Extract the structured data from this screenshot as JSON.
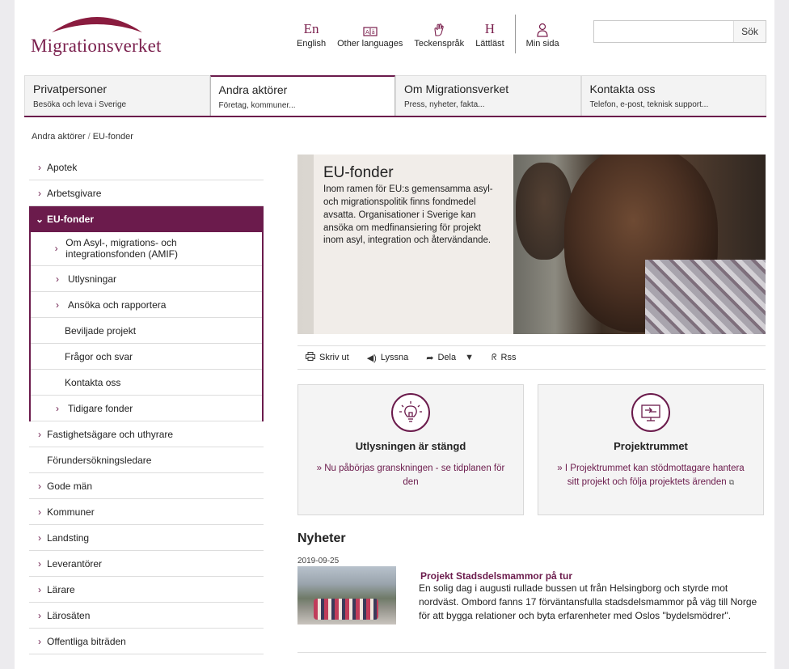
{
  "header": {
    "logo_text": "Migrationsverket",
    "top_links": [
      {
        "glyph": "En",
        "label": "English",
        "icon": "english-icon"
      },
      {
        "glyph": "A|ä",
        "label": "Other languages",
        "icon": "languages-icon"
      },
      {
        "glyph": "✋",
        "label": "Teckenspråk",
        "icon": "sign-language-icon"
      },
      {
        "glyph": "H",
        "label": "Lättläst",
        "icon": "easy-read-icon"
      }
    ],
    "my_page": {
      "label": "Min sida",
      "icon": "user-icon"
    },
    "search": {
      "placeholder": "",
      "button_label": "Sök"
    }
  },
  "main_nav": [
    {
      "title": "Privatpersoner",
      "subtitle": "Besöka och leva i Sverige"
    },
    {
      "title": "Andra aktörer",
      "subtitle": "Företag, kommuner..."
    },
    {
      "title": "Om Migrationsverket",
      "subtitle": "Press, nyheter, fakta..."
    },
    {
      "title": "Kontakta oss",
      "subtitle": "Telefon, e-post, teknisk support..."
    }
  ],
  "breadcrumb": {
    "parent": "Andra aktörer",
    "separator": "/",
    "current": "EU-fonder"
  },
  "sidebar": {
    "before": [
      {
        "label": "Apotek",
        "chevron": true
      },
      {
        "label": "Arbetsgivare",
        "chevron": true
      }
    ],
    "active": {
      "label": "EU-fonder"
    },
    "children": [
      {
        "label": "Om Asyl-, migrations- och integrationsfonden (AMIF)",
        "chevron": true
      },
      {
        "label": "Utlysningar",
        "chevron": true
      },
      {
        "label": "Ansöka och rapportera",
        "chevron": true
      },
      {
        "label": "Beviljade projekt",
        "chevron": false
      },
      {
        "label": "Frågor och svar",
        "chevron": false
      },
      {
        "label": "Kontakta oss",
        "chevron": false
      },
      {
        "label": "Tidigare fonder",
        "chevron": true
      }
    ],
    "after": [
      {
        "label": "Fastighetsägare och uthyrare",
        "chevron": true
      },
      {
        "label": "Förundersökningsledare",
        "chevron": false
      },
      {
        "label": "Gode män",
        "chevron": true
      },
      {
        "label": "Kommuner",
        "chevron": true
      },
      {
        "label": "Landsting",
        "chevron": true
      },
      {
        "label": "Leverantörer",
        "chevron": true
      },
      {
        "label": "Lärare",
        "chevron": true
      },
      {
        "label": "Lärosäten",
        "chevron": true
      },
      {
        "label": "Offentliga biträden",
        "chevron": true
      }
    ]
  },
  "hero": {
    "title": "EU-fonder",
    "text": "Inom ramen för EU:s gemensamma asyl- och migrationspolitik finns fondmedel avsatta. Organisationer i Sverige kan ansöka om medfinansiering för projekt inom asyl, integration och återvändande."
  },
  "tools": {
    "print": "Skriv ut",
    "listen": "Lyssna",
    "share": "Dela",
    "rss": "Rss"
  },
  "cards": [
    {
      "icon": "lightbulb-icon",
      "title": "Utlysningen är stängd",
      "link": "» Nu påbörjas granskningen - se tidplanen för den"
    },
    {
      "icon": "screen-icon",
      "title": "Projektrummet",
      "link": "» I Projektrummet kan stödmottagare hantera sitt projekt och följa projektets ärenden"
    }
  ],
  "news": {
    "heading": "Nyheter",
    "items": [
      {
        "date": "2019-09-25",
        "title": "Projekt Stadsdelsmammor på tur",
        "text": "En solig dag i augusti rullade bussen ut från Helsingborg och styrde mot nordväst. Ombord fanns 17 förväntansfulla stadsdelsmammor på väg till Norge för att bygga relationer och byta erfarenheter med Oslos \"bydelsmödrer\"."
      }
    ]
  },
  "colors": {
    "brand": "#6b1b4c",
    "card_bg": "#f4f4f4"
  }
}
